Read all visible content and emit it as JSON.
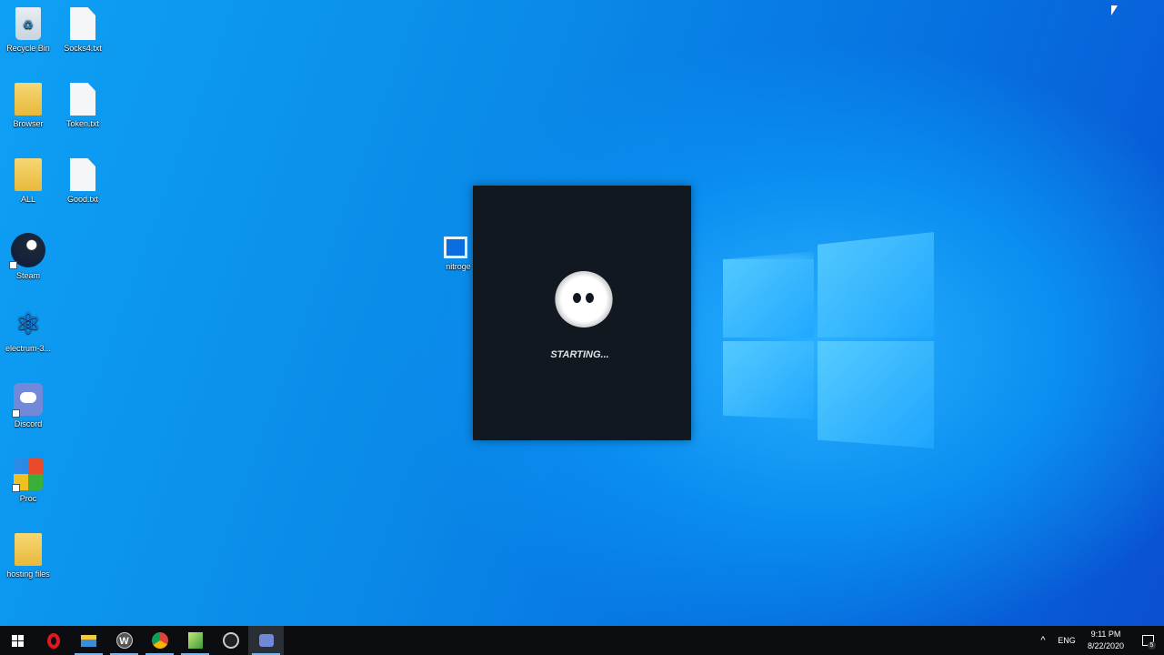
{
  "desktop": {
    "icons": [
      {
        "label": "Recycle Bin",
        "icon": "recycle-bin-icon"
      },
      {
        "label": "Socks4.txt",
        "icon": "text-file-icon"
      },
      {
        "label": "Browser",
        "icon": "folder-icon"
      },
      {
        "label": "Token.txt",
        "icon": "text-file-icon"
      },
      {
        "label": "ALL",
        "icon": "folder-icon"
      },
      {
        "label": "Good.txt",
        "icon": "text-file-icon"
      },
      {
        "label": "Steam",
        "icon": "steam-icon"
      },
      {
        "label": "electrum-3...",
        "icon": "electrum-icon"
      },
      {
        "label": "Discord",
        "icon": "discord-icon"
      },
      {
        "label": "Proc",
        "icon": "process-explorer-icon"
      },
      {
        "label": "hosting files",
        "icon": "folder-icon"
      },
      {
        "label": "nitroge",
        "icon": "app-icon"
      }
    ]
  },
  "splash": {
    "status": "STARTING..."
  },
  "taskbar": {
    "items": [
      "start",
      "opera",
      "file-explorer",
      "wps",
      "chrome",
      "notepad",
      "obs",
      "discord"
    ]
  },
  "tray": {
    "language": "ENG",
    "time": "9:11 PM",
    "date": "8/22/2020",
    "notifications": "5"
  }
}
